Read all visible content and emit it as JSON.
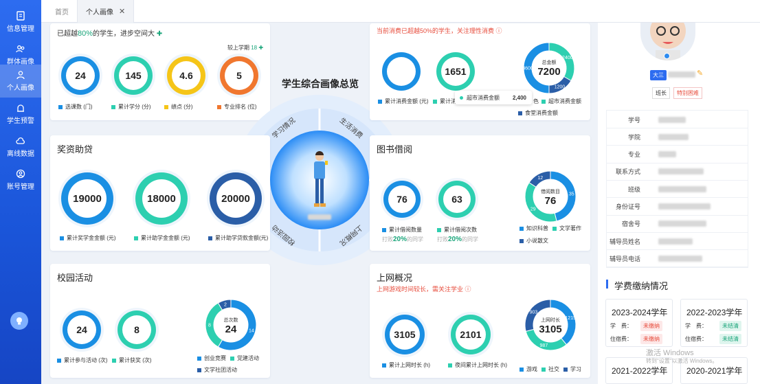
{
  "sidebar": {
    "items": [
      {
        "label": "信息管理",
        "icon": "id-card-icon"
      },
      {
        "label": "群体画像",
        "icon": "group-icon"
      },
      {
        "label": "个人画像",
        "icon": "person-icon"
      },
      {
        "label": "学生预警",
        "icon": "alarm-icon"
      },
      {
        "label": "离线数据",
        "icon": "cloud-icon"
      },
      {
        "label": "账号管理",
        "icon": "account-icon"
      }
    ],
    "active": 2,
    "bottom_icon": "lightbulb-icon"
  },
  "tabs": [
    {
      "label": "首页"
    },
    {
      "label": "个人画像"
    }
  ],
  "academic": {
    "note_a": "已超越",
    "note_pct": "80%",
    "note_b": "的学生，进步空间大",
    "compare": "较上学期",
    "compare_value": "18",
    "metrics": [
      {
        "value": "24",
        "label": "选课数 (门)",
        "color": "#1a8fe3"
      },
      {
        "value": "145",
        "label": "累计学分 (分)",
        "color": "#2dcfb0"
      },
      {
        "value": "4.6",
        "label": "绩点 (分)",
        "color": "#f5c518"
      },
      {
        "value": "5",
        "label": "专业排名 (位)",
        "color": "#f0772f"
      }
    ]
  },
  "center": {
    "title": "学生综合画像总览",
    "sectors": [
      "学习情况",
      "生活消费",
      "校园活动",
      "上网概况"
    ]
  },
  "consumption": {
    "note": "当前消费已超越50%的学生，关注理性消费",
    "metrics": [
      {
        "value": "",
        "label": "累计消费金额 (元)"
      },
      {
        "value": "1651",
        "label": "累计消"
      }
    ],
    "donut": {
      "center_label": "总金额",
      "center_value": "7200",
      "segments": [
        {
          "name": "超市消费金额",
          "value": 2400,
          "color": "#2dcfb0"
        },
        {
          "name": "食堂消费金额",
          "value": 1200,
          "color": "#2b5ea7"
        },
        {
          "name": "",
          "value": 3600,
          "color": "#1a8fe3"
        }
      ]
    },
    "tooltip": {
      "label": "超市消费金额",
      "value": "2,400"
    },
    "legend": [
      {
        "text": "色",
        "color": "#1a8fe3"
      },
      {
        "text": "超市消费金额",
        "color": "#2dcfb0"
      },
      {
        "text": "食堂消费金额",
        "color": "#2b5ea7"
      }
    ]
  },
  "scholarship": {
    "title": "奖资助贷",
    "metrics": [
      {
        "value": "19000",
        "label": "累计奖学金金额 (元)",
        "color": "#1a8fe3"
      },
      {
        "value": "18000",
        "label": "累计助学金金额 (元)",
        "color": "#2dcfb0"
      },
      {
        "value": "20000",
        "label": "累计助学贷款金额(元)",
        "color": "#2b5ea7"
      }
    ]
  },
  "library": {
    "title": "图书借阅",
    "metrics": [
      {
        "value": "76",
        "label": "累计借阅数量",
        "note_a": "打败",
        "note_pct": "20%",
        "note_b": "的同学",
        "color": "#1a8fe3"
      },
      {
        "value": "63",
        "label": "累计借阅次数",
        "note_a": "打败",
        "note_pct": "20%",
        "note_b": "的同学",
        "color": "#2dcfb0"
      }
    ],
    "donut": {
      "center_label": "借阅数目",
      "center_value": "76",
      "segments": [
        {
          "name": "知识科普",
          "value": 35,
          "color": "#1a8fe3"
        },
        {
          "name": "文学著作",
          "value": 29,
          "color": "#2dcfb0"
        },
        {
          "name": "小说散文",
          "value": 12,
          "color": "#2b5ea7"
        }
      ]
    }
  },
  "activities": {
    "title": "校园活动",
    "metrics": [
      {
        "value": "24",
        "label": "累计参与活动 (次)",
        "color": "#1a8fe3"
      },
      {
        "value": "8",
        "label": "累计获奖 (次)",
        "color": "#2dcfb0"
      }
    ],
    "donut": {
      "center_label": "总次数",
      "center_value": "24",
      "segments": [
        {
          "name": "创业竞赛",
          "value": 14,
          "color": "#1a8fe3"
        },
        {
          "name": "党建活动",
          "value": 8,
          "color": "#2dcfb0"
        },
        {
          "name": "文学社团活动",
          "value": 2,
          "color": "#2b5ea7"
        }
      ]
    }
  },
  "internet": {
    "title": "上网概况",
    "note": "上网游戏时间较长，需关注学业",
    "metrics": [
      {
        "value": "3105",
        "label": "累计上网时长 (h)",
        "color": "#1a8fe3"
      },
      {
        "value": "2101",
        "label": "夜间累计上网时长 (h)",
        "color": "#2dcfb0"
      }
    ],
    "donut": {
      "center_label": "上网时长",
      "center_value": "3105",
      "segments": [
        {
          "name": "游戏",
          "value": 1215,
          "color": "#1a8fe3"
        },
        {
          "name": "社交",
          "value": 987,
          "color": "#2dcfb0"
        },
        {
          "name": "学习",
          "value": 903,
          "color": "#2b5ea7"
        }
      ]
    }
  },
  "profile": {
    "grade": "大三",
    "tags": [
      "班长",
      "特别困难"
    ],
    "fields": [
      "学号",
      "学院",
      "专业",
      "联系方式",
      "班级",
      "身份证号",
      "宿舍号",
      "辅导员姓名",
      "辅导员电话"
    ]
  },
  "fees": {
    "title": "学费缴纳情况",
    "years": [
      {
        "year": "2023-2024学年",
        "tuition_label": "学　费：",
        "tuition_status": "未缴纳",
        "tuition_kind": "red",
        "housing_label": "住宿费：",
        "housing_status": "未缴纳",
        "housing_kind": "red"
      },
      {
        "year": "2022-2023学年",
        "tuition_label": "学　费：",
        "tuition_status": "未结清",
        "tuition_kind": "green",
        "housing_label": "住宿费：",
        "housing_status": "未结清",
        "housing_kind": "green"
      },
      {
        "year": "2021-2022学年"
      },
      {
        "year": "2020-2021学年"
      }
    ]
  },
  "watermark": {
    "line1": "激活 Windows",
    "line2": "转到\"设置\"以激活 Windows。"
  }
}
